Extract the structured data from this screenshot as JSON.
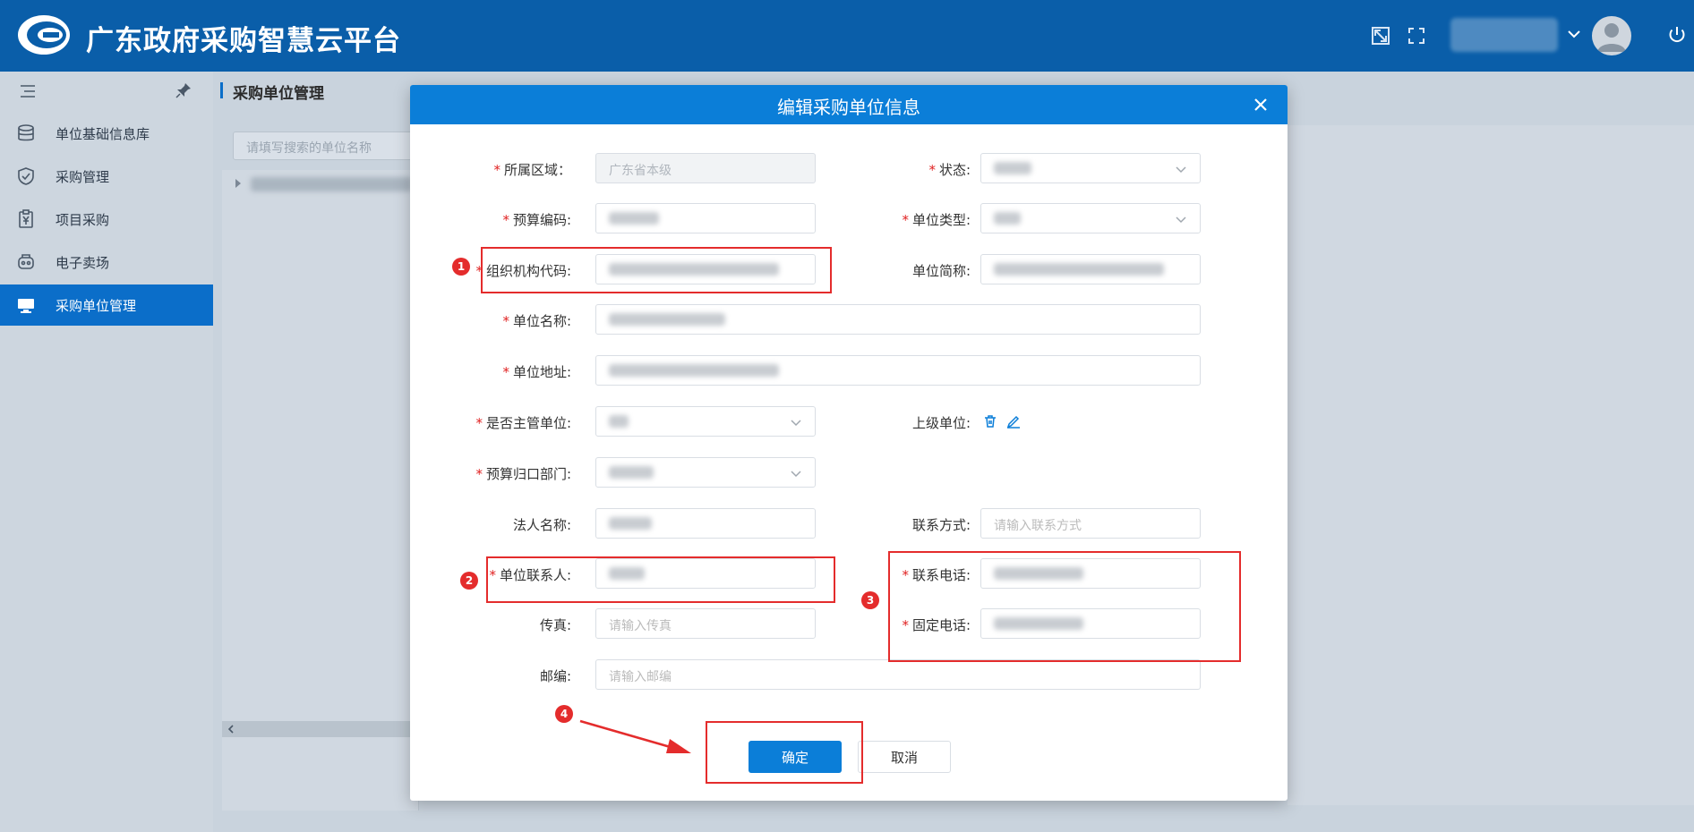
{
  "header": {
    "brand": "广东政府采购智慧云平台",
    "icons": [
      "fullscreen-exit-icon",
      "fullscreen-icon",
      "chevron-down-icon",
      "user-avatar",
      "power-icon"
    ],
    "color": "#0a5ea9"
  },
  "sidebar": {
    "items": [
      {
        "label": "单位基础信息库",
        "icon": "database-icon"
      },
      {
        "label": "采购管理",
        "icon": "shield-icon"
      },
      {
        "label": "项目采购",
        "icon": "clipboard-yuan-icon"
      },
      {
        "label": "电子卖场",
        "icon": "store-icon"
      },
      {
        "label": "采购单位管理",
        "icon": "monitor-icon",
        "active": true
      }
    ]
  },
  "content": {
    "breadcrumb": "采购单位管理",
    "search_placeholder": "请填写搜索的单位名称"
  },
  "modal": {
    "title": "编辑采购单位信息",
    "fields": {
      "region": {
        "label": "所属区域：",
        "value": "广东省本级"
      },
      "status": {
        "label": "状态:"
      },
      "budget_code": {
        "label": "预算编码:"
      },
      "unit_type": {
        "label": "单位类型:"
      },
      "org_code": {
        "label": "组织机构代码:"
      },
      "short_name": {
        "label": "单位简称:"
      },
      "unit_name": {
        "label": "单位名称:"
      },
      "unit_address": {
        "label": "单位地址:"
      },
      "is_supervisor": {
        "label": "是否主管单位:"
      },
      "superior": {
        "label": "上级单位:"
      },
      "budget_dept": {
        "label": "预算归口部门:"
      },
      "legal_name": {
        "label": "法人名称:"
      },
      "contact_method": {
        "label": "联系方式:",
        "placeholder": "请输入联系方式"
      },
      "contact_person": {
        "label": "单位联系人:"
      },
      "contact_phone": {
        "label": "联系电话:"
      },
      "fax": {
        "label": "传真:",
        "placeholder": "请输入传真"
      },
      "landline": {
        "label": "固定电话:"
      },
      "postcode": {
        "label": "邮编:",
        "placeholder": "请输入邮编"
      }
    },
    "buttons": {
      "ok": "确定",
      "cancel": "取消"
    },
    "annotations": [
      "1",
      "2",
      "3",
      "4"
    ],
    "accent": "#0b7ed8",
    "annotation_color": "#e42c2c"
  }
}
